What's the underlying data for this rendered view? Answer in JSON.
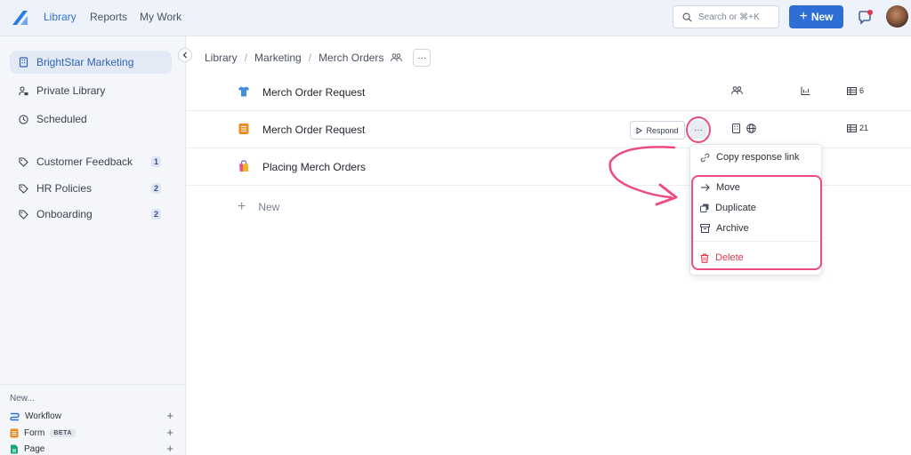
{
  "topbar": {
    "nav": [
      "Library",
      "Reports",
      "My Work"
    ],
    "search_placeholder": "Search or ⌘+K",
    "new_label": "New",
    "colors": {
      "accent": "#2d6fd4",
      "notification": "#e3324a"
    }
  },
  "sidebar": {
    "items": [
      {
        "label": "BrightStar Marketing",
        "icon": "building-icon",
        "active": true
      },
      {
        "label": "Private Library",
        "icon": "person-lock-icon"
      },
      {
        "label": "Scheduled",
        "icon": "clock-icon"
      }
    ],
    "tags": [
      {
        "label": "Customer Feedback",
        "badge": "1"
      },
      {
        "label": "HR Policies",
        "badge": "2"
      },
      {
        "label": "Onboarding",
        "badge": "2"
      }
    ],
    "create": {
      "heading": "New...",
      "items": [
        {
          "label": "Workflow",
          "icon": "workflow-icon"
        },
        {
          "label": "Form",
          "icon": "form-icon",
          "badge": "BETA"
        },
        {
          "label": "Page",
          "icon": "page-icon"
        }
      ]
    }
  },
  "breadcrumb": [
    "Library",
    "Marketing",
    "Merch Orders"
  ],
  "rows": [
    {
      "title": "Merch Order Request",
      "icon": "tshirt-icon",
      "count": "6"
    },
    {
      "title": "Merch Order Request",
      "icon": "form-icon",
      "count": "21",
      "respond_label": "Respond"
    },
    {
      "title": "Placing Merch Orders",
      "icon": "shopping-bag-icon"
    }
  ],
  "new_row_label": "New",
  "menu": {
    "items": [
      {
        "label": "Copy response link",
        "icon": "link-icon"
      },
      {
        "label": "Move",
        "icon": "arrow-right-icon"
      },
      {
        "label": "Duplicate",
        "icon": "duplicate-icon"
      },
      {
        "label": "Archive",
        "icon": "archive-icon"
      },
      {
        "label": "Delete",
        "icon": "trash-icon",
        "danger": true
      }
    ]
  },
  "annotation_color": "#ec4d7e"
}
